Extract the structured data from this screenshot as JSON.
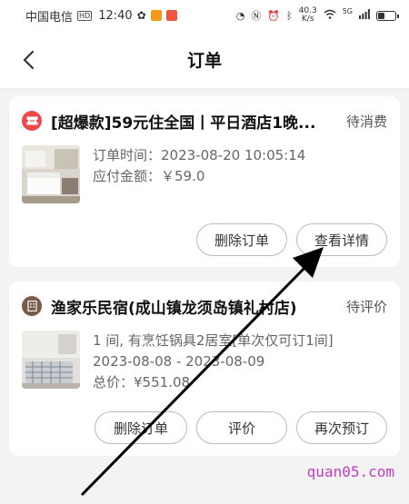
{
  "statusbar": {
    "carrier": "中国电信",
    "hd_badge": "HD",
    "time": "12:40",
    "net_speed_value": "40.3",
    "net_speed_unit": "K/s",
    "signal_label": "5G",
    "battery_level": 0.4
  },
  "header": {
    "title": "订单"
  },
  "orders": [
    {
      "title": "[超爆款]59元住全国丨平日酒店1晚...",
      "status": "待消费",
      "lines": [
        "订单时间：2023-08-20 10:05:14",
        "应付金额：￥59.0"
      ],
      "buttons": [
        "删除订单",
        "查看详情"
      ]
    },
    {
      "title": "渔家乐民宿(成山镇龙须岛镇礼村店)",
      "status": "待评价",
      "lines": [
        "1 间, 有烹饪锅具2居室[单次仅可订1间]",
        "2023-08-08 - 2023-08-09",
        "总价：¥551.08"
      ],
      "buttons": [
        "删除订单",
        "评价",
        "再次预订"
      ]
    }
  ],
  "watermark": "quan05.com",
  "colors": {
    "ticket_icon": "#ec4a4a",
    "hotel_icon": "#7a5a48",
    "watermark": "#c23ec0"
  }
}
